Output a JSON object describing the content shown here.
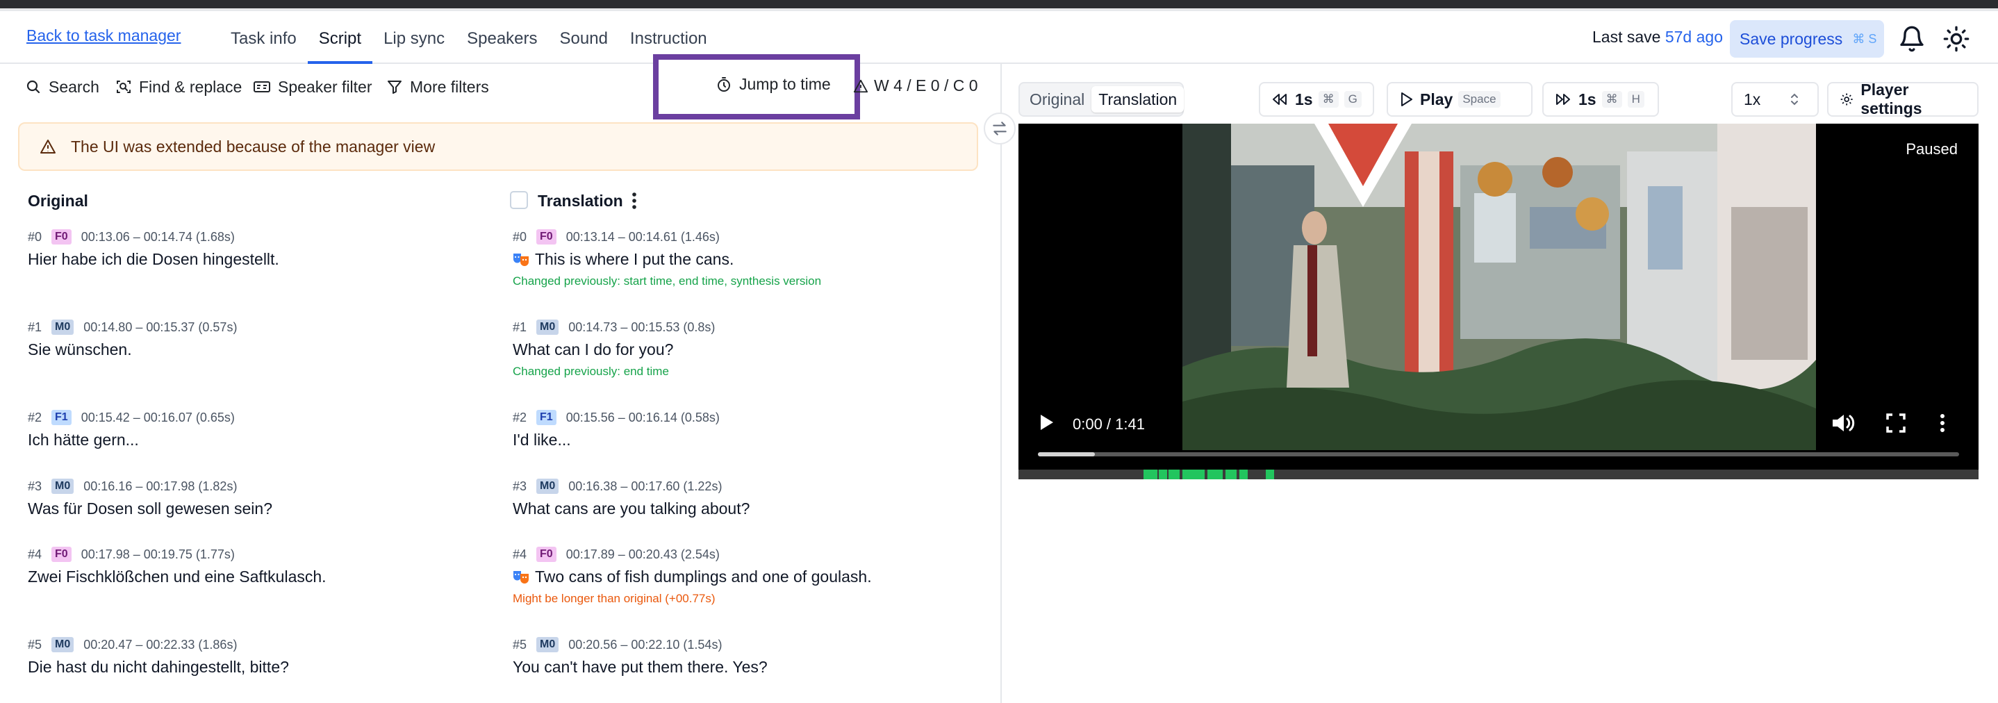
{
  "header": {
    "back_link": "Back to task manager",
    "tabs": [
      {
        "label": "Task info"
      },
      {
        "label": "Script"
      },
      {
        "label": "Lip sync"
      },
      {
        "label": "Speakers"
      },
      {
        "label": "Sound"
      },
      {
        "label": "Instruction"
      }
    ],
    "active_tab": "Script",
    "last_save_label": "Last save",
    "last_save_ago": "57d ago",
    "save_button": "Save progress",
    "save_shortcut": "⌘ S"
  },
  "toolbar": {
    "search": "Search",
    "find_replace": "Find & replace",
    "speaker_filter": "Speaker filter",
    "more_filters": "More filters",
    "jump_to_time": "Jump to time",
    "warnings": "W 4 / E 0 / C 0"
  },
  "banner": {
    "text": "The UI was extended because of the manager view"
  },
  "columns": {
    "original": "Original",
    "translation": "Translation"
  },
  "original_segments": [
    {
      "num": "#0",
      "speaker": "F0",
      "time": "00:13.06 – 00:14.74 (1.68s)",
      "text": "Hier habe ich die Dosen hingestellt."
    },
    {
      "num": "#1",
      "speaker": "M0",
      "time": "00:14.80 – 00:15.37 (0.57s)",
      "text": "Sie wünschen."
    },
    {
      "num": "#2",
      "speaker": "F1",
      "time": "00:15.42 – 00:16.07 (0.65s)",
      "text": "Ich hätte gern..."
    },
    {
      "num": "#3",
      "speaker": "M0",
      "time": "00:16.16 – 00:17.98 (1.82s)",
      "text": "Was für Dosen soll gewesen sein?"
    },
    {
      "num": "#4",
      "speaker": "F0",
      "time": "00:17.98 – 00:19.75 (1.77s)",
      "text": "Zwei Fischklößchen und eine Saftkulasch."
    },
    {
      "num": "#5",
      "speaker": "M0",
      "time": "00:20.47 – 00:22.33 (1.86s)",
      "text": "Die hast du nicht dahingestellt, bitte?"
    }
  ],
  "translation_segments": [
    {
      "num": "#0",
      "speaker": "F0",
      "time": "00:13.14 – 00:14.61 (1.46s)",
      "text": "This is where I put the cans.",
      "note": "Changed previously: start time, end time, synthesis version"
    },
    {
      "num": "#1",
      "speaker": "M0",
      "time": "00:14.73 – 00:15.53 (0.8s)",
      "text": "What can I do for you?",
      "note": "Changed previously: end time"
    },
    {
      "num": "#2",
      "speaker": "F1",
      "time": "00:15.56 – 00:16.14 (0.58s)",
      "text": "I'd like..."
    },
    {
      "num": "#3",
      "speaker": "M0",
      "time": "00:16.38 – 00:17.60 (1.22s)",
      "text": "What cans are you talking about?"
    },
    {
      "num": "#4",
      "speaker": "F0",
      "time": "00:17.89 – 00:20.43 (2.54s)",
      "text": "Two cans of fish dumplings and one of goulash.",
      "note": "Might be longer than original (+00.77s)"
    },
    {
      "num": "#5",
      "speaker": "M0",
      "time": "00:20.56 – 00:22.10 (1.54s)",
      "text": "You can't have put them there. Yes?"
    }
  ],
  "player": {
    "view_original": "Original",
    "view_translation": "Translation",
    "back_step": "1s",
    "back_keys": [
      "⌘",
      "G"
    ],
    "play": "Play",
    "play_key": "Space",
    "forward_step": "1s",
    "forward_keys": [
      "⌘",
      "H"
    ],
    "speed": "1x",
    "settings": "Player settings",
    "status": "Paused",
    "timecode": "0:00 / 1:41"
  },
  "colors": {
    "accent": "#2563eb",
    "highlight_frame": "#6b3fa0",
    "note_green": "#16a34a",
    "note_orange": "#ea580c",
    "waveform": "#22c55e"
  }
}
